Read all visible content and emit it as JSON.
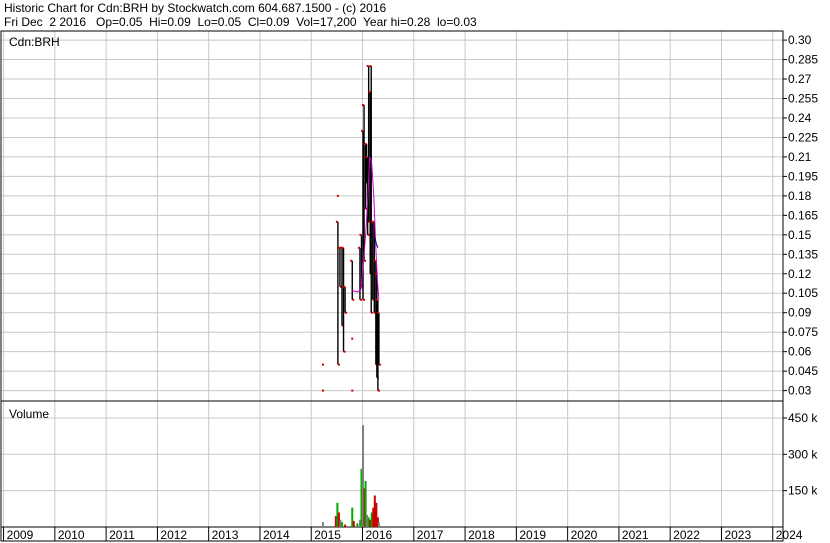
{
  "header": {
    "line1": "Historic Chart for Cdn:BRH by Stockwatch.com 604.687.1500 - (c) 2016",
    "line2": "Fri Dec  2 2016   Op=0.05  Hi=0.09  Lo=0.05  Cl=0.09  Vol=17,200  Year hi=0.28  lo=0.03"
  },
  "chart_data": {
    "type": "bar",
    "symbol_label": "Cdn:BRH",
    "volume_label": "Volume",
    "grid": true,
    "price_axis": {
      "ticks": [
        0.3,
        0.285,
        0.27,
        0.255,
        0.24,
        0.225,
        0.21,
        0.195,
        0.18,
        0.165,
        0.15,
        0.135,
        0.12,
        0.105,
        0.09,
        0.075,
        0.06,
        0.045,
        0.03
      ],
      "tick_labels": [
        "0.30",
        "0.285",
        "0.27",
        "0.255",
        "0.24",
        "0.225",
        "0.21",
        "0.195",
        "0.18",
        "0.165",
        "0.15",
        "0.135",
        "0.12",
        "0.105",
        "0.09",
        "0.075",
        "0.06",
        "0.045",
        "0.03"
      ],
      "ylim": [
        0.022,
        0.307
      ]
    },
    "volume_axis": {
      "ticks": [
        150000,
        300000,
        450000
      ],
      "tick_labels": [
        "150 k",
        "300 k",
        "450 k"
      ],
      "ylim": [
        0,
        520000
      ]
    },
    "x_axis": {
      "years": [
        "2009",
        "2010",
        "2011",
        "2012",
        "2013",
        "2014",
        "2015",
        "2016",
        "2017",
        "2018",
        "2019",
        "2020",
        "2021",
        "2022",
        "2023",
        "2024"
      ],
      "xlim": [
        2008.95,
        2024.2
      ]
    },
    "price_bars": [
      {
        "t": 2015.23,
        "hi": 0.05,
        "lo": 0.05,
        "kind": "dot"
      },
      {
        "t": 2015.23,
        "hi": 0.03,
        "lo": 0.03,
        "kind": "dot"
      },
      {
        "t": 2015.52,
        "hi": 0.16,
        "lo": 0.05,
        "kind": "bar"
      },
      {
        "t": 2015.52,
        "hi": 0.18,
        "lo": 0.18,
        "kind": "dot"
      },
      {
        "t": 2015.56,
        "hi": 0.14,
        "lo": 0.11,
        "kind": "bar"
      },
      {
        "t": 2015.6,
        "hi": 0.14,
        "lo": 0.08,
        "kind": "bar"
      },
      {
        "t": 2015.63,
        "hi": 0.14,
        "lo": 0.06,
        "kind": "bar"
      },
      {
        "t": 2015.66,
        "hi": 0.11,
        "lo": 0.09,
        "kind": "bar"
      },
      {
        "t": 2015.8,
        "hi": 0.13,
        "lo": 0.1,
        "kind": "bar"
      },
      {
        "t": 2015.8,
        "hi": 0.07,
        "lo": 0.07,
        "kind": "dot"
      },
      {
        "t": 2015.8,
        "hi": 0.03,
        "lo": 0.03,
        "kind": "dot"
      },
      {
        "t": 2015.95,
        "hi": 0.14,
        "lo": 0.1,
        "kind": "bar"
      },
      {
        "t": 2015.98,
        "hi": 0.15,
        "lo": 0.11,
        "kind": "bar"
      },
      {
        "t": 2016.01,
        "hi": 0.23,
        "lo": 0.1,
        "kind": "bar"
      },
      {
        "t": 2016.03,
        "hi": 0.25,
        "lo": 0.13,
        "kind": "bar"
      },
      {
        "t": 2016.06,
        "hi": 0.22,
        "lo": 0.17,
        "kind": "bar"
      },
      {
        "t": 2016.08,
        "hi": 0.22,
        "lo": 0.19,
        "kind": "bar"
      },
      {
        "t": 2016.1,
        "hi": 0.21,
        "lo": 0.15,
        "kind": "bar"
      },
      {
        "t": 2016.12,
        "hi": 0.28,
        "lo": 0.16,
        "kind": "bar"
      },
      {
        "t": 2016.15,
        "hi": 0.26,
        "lo": 0.12,
        "kind": "bar"
      },
      {
        "t": 2016.17,
        "hi": 0.28,
        "lo": 0.09,
        "kind": "bar"
      },
      {
        "t": 2016.2,
        "hi": 0.16,
        "lo": 0.1,
        "kind": "bar"
      },
      {
        "t": 2016.23,
        "hi": 0.16,
        "lo": 0.09,
        "kind": "bar"
      },
      {
        "t": 2016.26,
        "hi": 0.13,
        "lo": 0.05,
        "kind": "bar"
      },
      {
        "t": 2016.28,
        "hi": 0.12,
        "lo": 0.04,
        "kind": "bar"
      },
      {
        "t": 2016.3,
        "hi": 0.1,
        "lo": 0.03,
        "kind": "bar"
      },
      {
        "t": 2016.32,
        "hi": 0.09,
        "lo": 0.05,
        "kind": "bar"
      }
    ],
    "moving_average": {
      "color": "#cc00cc",
      "points": [
        [
          2015.8,
          0.107
        ],
        [
          2015.9,
          0.106
        ],
        [
          2015.97,
          0.108
        ],
        [
          2016.02,
          0.13
        ],
        [
          2016.06,
          0.15
        ],
        [
          2016.1,
          0.175
        ],
        [
          2016.14,
          0.21
        ],
        [
          2016.18,
          0.205
        ],
        [
          2016.22,
          0.18
        ],
        [
          2016.26,
          0.14
        ],
        [
          2016.29,
          0.115
        ],
        [
          2016.32,
          0.1
        ]
      ]
    },
    "short_average": {
      "color": "#000080",
      "points": [
        [
          2016.24,
          0.148
        ],
        [
          2016.27,
          0.143
        ],
        [
          2016.3,
          0.14
        ]
      ]
    },
    "volume_bars": [
      {
        "t": 2015.23,
        "v": 20000,
        "color": "#808080"
      },
      {
        "t": 2015.48,
        "v": 45000,
        "color": "#cc0000"
      },
      {
        "t": 2015.51,
        "v": 100000,
        "color": "#00aa00"
      },
      {
        "t": 2015.54,
        "v": 60000,
        "color": "#cc0000"
      },
      {
        "t": 2015.57,
        "v": 30000,
        "color": "#808080"
      },
      {
        "t": 2015.6,
        "v": 20000,
        "color": "#00aa00"
      },
      {
        "t": 2015.66,
        "v": 10000,
        "color": "#cc0000"
      },
      {
        "t": 2015.8,
        "v": 80000,
        "color": "#00aa00"
      },
      {
        "t": 2015.83,
        "v": 25000,
        "color": "#cc0000"
      },
      {
        "t": 2015.9,
        "v": 15000,
        "color": "#00aa00"
      },
      {
        "t": 2015.95,
        "v": 30000,
        "color": "#808080"
      },
      {
        "t": 2015.98,
        "v": 240000,
        "color": "#00aa00"
      },
      {
        "t": 2016.01,
        "v": 420000,
        "color": "#808080"
      },
      {
        "t": 2016.04,
        "v": 160000,
        "color": "#cc0000"
      },
      {
        "t": 2016.06,
        "v": 190000,
        "color": "#00aa00"
      },
      {
        "t": 2016.09,
        "v": 50000,
        "color": "#808080"
      },
      {
        "t": 2016.12,
        "v": 40000,
        "color": "#00aa00"
      },
      {
        "t": 2016.15,
        "v": 30000,
        "color": "#cc0000"
      },
      {
        "t": 2016.18,
        "v": 60000,
        "color": "#00aa00"
      },
      {
        "t": 2016.21,
        "v": 80000,
        "color": "#cc0000"
      },
      {
        "t": 2016.24,
        "v": 130000,
        "color": "#cc0000"
      },
      {
        "t": 2016.27,
        "v": 100000,
        "color": "#cc0000"
      },
      {
        "t": 2016.3,
        "v": 40000,
        "color": "#cc0000"
      },
      {
        "t": 2016.32,
        "v": 20000,
        "color": "#808080"
      }
    ]
  }
}
